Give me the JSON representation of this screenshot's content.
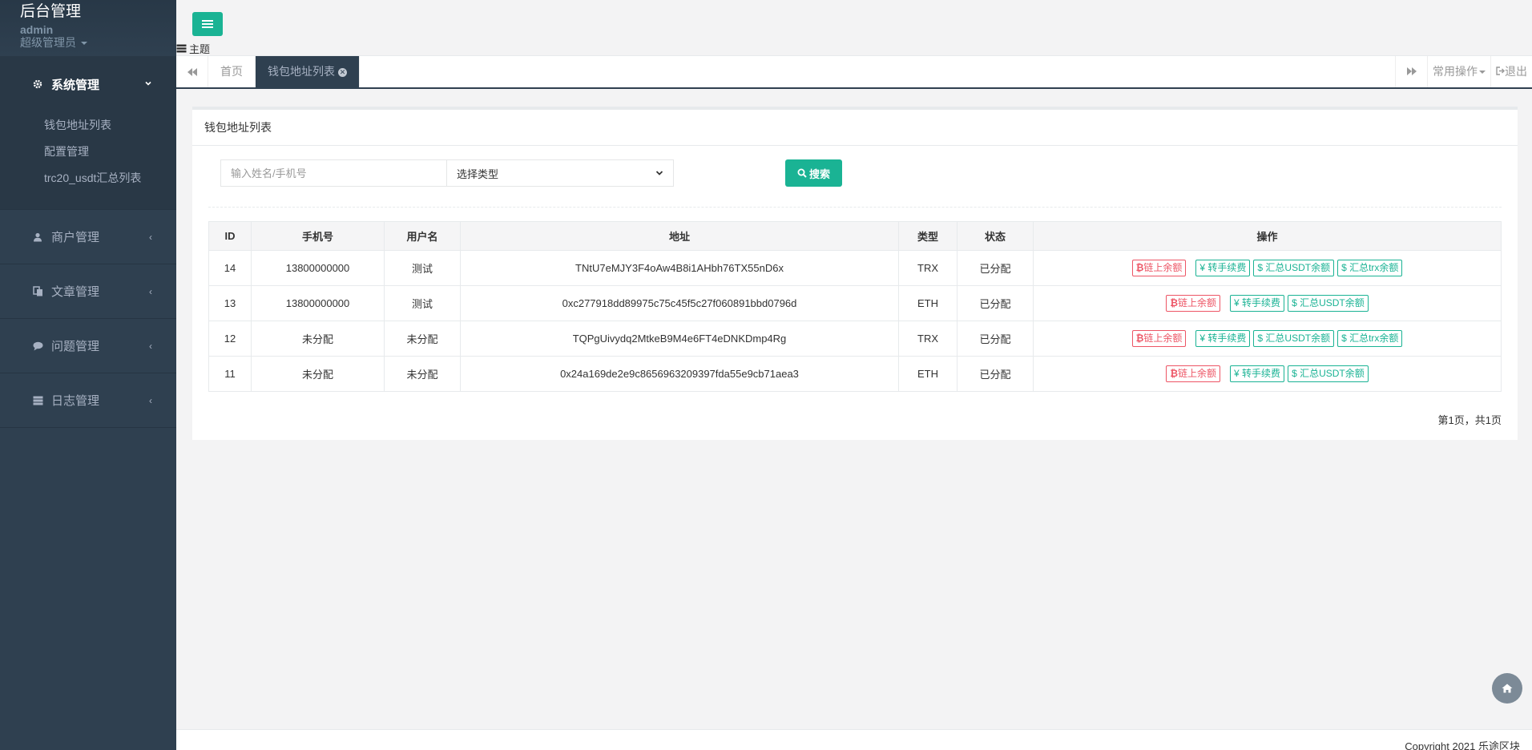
{
  "sidebar": {
    "title": "后台管理",
    "user": "admin",
    "role": "超级管理员",
    "groups": [
      {
        "label": "系统管理",
        "icon": "gear-icon",
        "expanded": true,
        "items": [
          "钱包地址列表",
          "配置管理",
          "trc20_usdt汇总列表"
        ]
      },
      {
        "label": "商户管理",
        "icon": "user-icon"
      },
      {
        "label": "文章管理",
        "icon": "copy-icon"
      },
      {
        "label": "问题管理",
        "icon": "comment-icon"
      },
      {
        "label": "日志管理",
        "icon": "server-icon"
      }
    ]
  },
  "topbar": {
    "theme_label": "主题"
  },
  "tabs": {
    "home": "首页",
    "active": "钱包地址列表",
    "common_ops": "常用操作",
    "logout": "退出"
  },
  "panel": {
    "title": "钱包地址列表",
    "search_placeholder": "输入姓名/手机号",
    "select_value": "选择类型",
    "search_button": "搜索"
  },
  "table": {
    "headers": [
      "ID",
      "手机号",
      "用户名",
      "地址",
      "类型",
      "状态",
      "操作"
    ],
    "rows": [
      {
        "id": "14",
        "phone": "13800000000",
        "username": "测试",
        "address": "TNtU7eMJY3F4oAw4B8i1AHbh76TX55nD6x",
        "type": "TRX",
        "status": "已分配",
        "ops": [
          "链上余额",
          "转手续费",
          "汇总USDT余额",
          "汇总trx余额"
        ]
      },
      {
        "id": "13",
        "phone": "13800000000",
        "username": "测试",
        "address": "0xc277918dd89975c75c45f5c27f060891bbd0796d",
        "type": "ETH",
        "status": "已分配",
        "ops": [
          "链上余额",
          "转手续费",
          "汇总USDT余额"
        ]
      },
      {
        "id": "12",
        "phone": "未分配",
        "username": "未分配",
        "address": "TQPgUivydq2MtkeB9M4e6FT4eDNKDmp4Rg",
        "type": "TRX",
        "status": "已分配",
        "ops": [
          "链上余额",
          "转手续费",
          "汇总USDT余额",
          "汇总trx余额"
        ]
      },
      {
        "id": "11",
        "phone": "未分配",
        "username": "未分配",
        "address": "0x24a169de2e9c8656963209397fda55e9cb71aea3",
        "type": "ETH",
        "status": "已分配",
        "ops": [
          "链上余额",
          "转手续费",
          "汇总USDT余额"
        ]
      }
    ]
  },
  "pager": "第1页，共1页",
  "footer": "Copyright 2021 乐途区块",
  "colors": {
    "sidebar": "#2f4050",
    "primary": "#1ab394",
    "danger": "#ed5565"
  }
}
